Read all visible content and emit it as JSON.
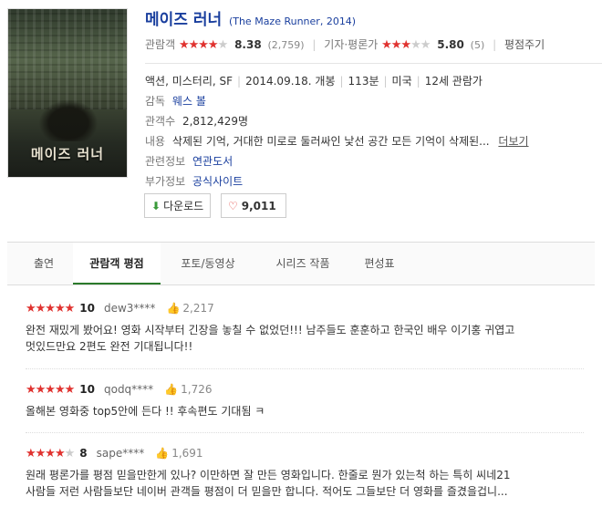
{
  "movie": {
    "title_kr": "메이즈 러너",
    "title_en": "(The Maze Runner, 2014)",
    "poster_text": "메이즈 러너",
    "audience_label": "관람객",
    "audience_stars": 4,
    "audience_score": "8.38",
    "audience_count": "(2,759)",
    "critic_label": "기자·평론가",
    "critic_stars": 3,
    "critic_score": "5.80",
    "critic_count": "(5)",
    "write_review": "평점주기",
    "genre": "액션, 미스터리, SF",
    "release": "2014.09.18. 개봉",
    "runtime": "113분",
    "country": "미국",
    "rating": "12세 관람가",
    "director_label": "감독",
    "director": "웨스 볼",
    "viewers_label": "관객수",
    "viewers": "2,812,429명",
    "content_label": "내용",
    "content": "삭제된 기억, 거대한 미로로 둘러싸인 낯선 공간 모든 기억이 삭제된...",
    "more": "더보기",
    "related_label": "관련정보",
    "related": "연관도서",
    "extra_label": "부가정보",
    "extra": "공식사이트"
  },
  "buttons": {
    "download": "다운로드",
    "likes": "9,011"
  },
  "tabs": [
    {
      "label": "출연"
    },
    {
      "label": "관람객 평점"
    },
    {
      "label": "포토/동영상"
    },
    {
      "label": "시리즈 작품"
    },
    {
      "label": "편성표"
    }
  ],
  "reviews": [
    {
      "stars": 5,
      "score": "10",
      "user": "dew3****",
      "likes": "2,217",
      "line1": "완전 재밌게 봤어요! 영화 시작부터 긴장을 놓칠 수 없었던!!! 남주들도 훈훈하고 한국인 배우 이기홍 귀엽고",
      "line2": "멋있드만요 2편도 완전 기대됩니다!!"
    },
    {
      "stars": 5,
      "score": "10",
      "user": "qodq****",
      "likes": "1,726",
      "line1": "올해본 영화중 top5안에 든다 !! 후속편도 기대됨 ㅋ",
      "line2": ""
    },
    {
      "stars": 4,
      "score": "8",
      "user": "sape****",
      "likes": "1,691",
      "line1": "원래 평론가를 평점 믿을만한게 있나? 이만하면 잘 만든 영화입니다. 한줄로 뭔가 있는척 하는 특히 씨네21",
      "line2": "사람들 저런 사람들보단 네이버 관객들 평점이 더 믿을만 합니다. 적어도 그들보단 더 영화를 즐겼을겁니..."
    }
  ],
  "colors": {
    "accent": "#1a3f9e",
    "star": "#e0322f",
    "tab_active": "#2b7a2b"
  }
}
